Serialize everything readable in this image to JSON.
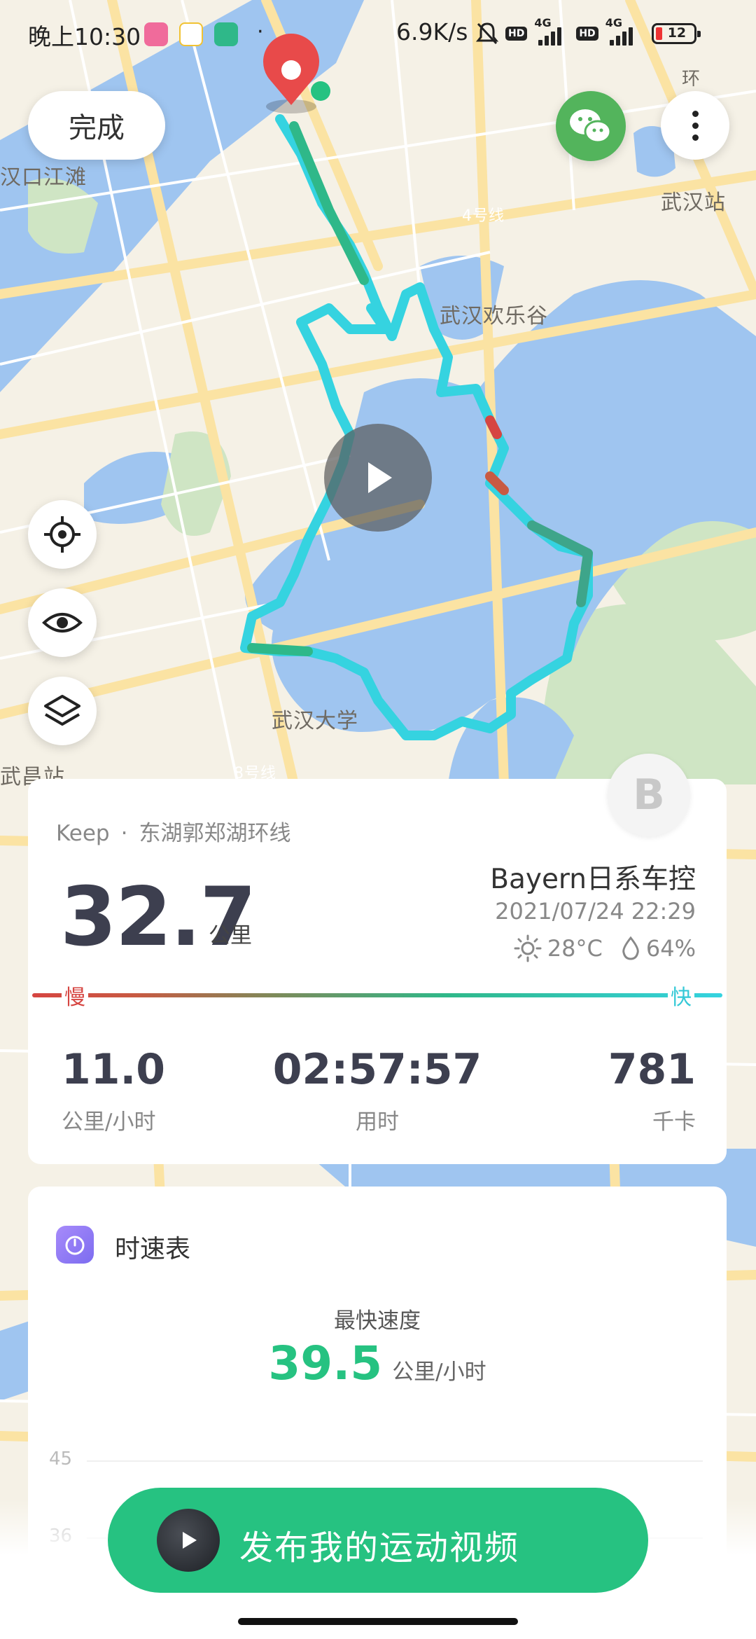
{
  "status_bar": {
    "time": "晚上10:30",
    "separator_dot": "·",
    "net_speed": "6.9K/s",
    "hd_badge": "HD",
    "network_type": "4G",
    "battery_level": "12",
    "icons": [
      "bilibili-icon",
      "app-icon",
      "security-icon",
      "mute-icon",
      "signal-icon",
      "battery-icon"
    ]
  },
  "toolbar": {
    "done_label": "完成"
  },
  "map": {
    "labels": {
      "hankou": "汉口江滩",
      "wuhan_station": "武汉站",
      "happy_valley": "武汉欢乐谷",
      "wuhan_university": "武汉大学",
      "wuchang_station": "武昌站",
      "line4": "4号线",
      "line8": "8号线",
      "ring": "环"
    },
    "colors": {
      "land": "#f5f1e6",
      "water": "#9fc5f0",
      "park": "#cfe5c4",
      "road": "#fbe3a3",
      "route_fast": "#35d3e0",
      "route_mid": "#2fb889",
      "route_slow": "#d64541"
    }
  },
  "summary": {
    "source_app": "Keep",
    "source_sep": "·",
    "route_name": "东湖郭郑湖环线",
    "distance": "32.7",
    "distance_unit": "公里",
    "car_name": "Bayern日系车控",
    "datetime": "2021/07/24 22:29",
    "temperature": "28°C",
    "humidity": "64%",
    "avatar_letter": "B",
    "slow_label": "慢",
    "fast_label": "快",
    "avg_speed": "11.0",
    "avg_speed_label": "公里/小时",
    "duration": "02:57:57",
    "duration_label": "用时",
    "calories": "781",
    "calories_label": "千卡"
  },
  "speedometer": {
    "title": "时速表",
    "max_speed_label": "最快速度",
    "max_speed": "39.5",
    "max_speed_unit": "公里/小时",
    "axis_top": "45",
    "axis_next": "36"
  },
  "cta": {
    "publish_label": "发布我的运动视频"
  },
  "colors": {
    "accent_green": "#26c281",
    "wechat_green": "#53b45c",
    "title_dark": "#3d3f4f"
  }
}
